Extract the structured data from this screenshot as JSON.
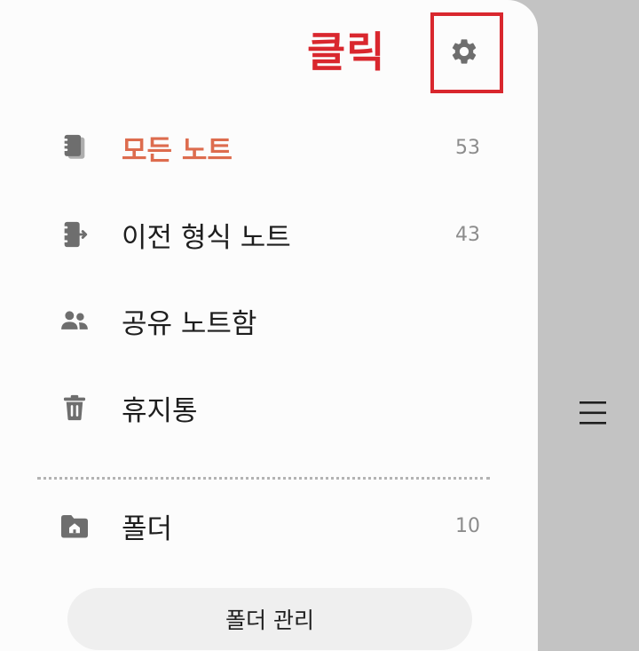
{
  "annotation": {
    "text": "클릭"
  },
  "header": {
    "settings_icon": "gear-icon"
  },
  "nav": {
    "items": [
      {
        "label": "모든 노트",
        "count": "53",
        "icon": "notebook-stack-icon",
        "active": true
      },
      {
        "label": "이전 형식 노트",
        "count": "43",
        "icon": "notebook-arrow-icon"
      },
      {
        "label": "공유 노트함",
        "icon": "people-icon"
      },
      {
        "label": "휴지통",
        "icon": "trash-icon"
      }
    ]
  },
  "folders": {
    "label": "폴더",
    "count": "10",
    "icon": "folder-home-icon"
  },
  "manage_button": {
    "label": "폴더 관리"
  },
  "side_panel": {
    "menu_icon": "hamburger-menu-icon"
  },
  "colors": {
    "active": "#dd6c4e",
    "annotation": "#d9272e",
    "icon": "#6e6e6e",
    "backdrop": "#c3c3c3"
  }
}
